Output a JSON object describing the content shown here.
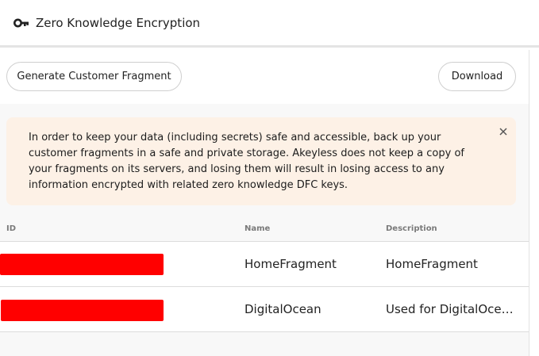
{
  "header": {
    "title": "Zero Knowledge Encryption",
    "icon": "key-icon"
  },
  "toolbar": {
    "generate_label": "Generate Customer Fragment",
    "download_label": "Download"
  },
  "alert": {
    "message": "In order to keep your data (including secrets) safe and accessible, back up your customer fragments in a safe and private storage. Akeyless does not keep a copy of your fragments on its servers, and losing them will result in losing access to any information encrypted with related zero knowledge DFC keys.",
    "background": "#fdf1e6"
  },
  "table": {
    "columns": [
      "ID",
      "Name",
      "Description"
    ],
    "rows": [
      {
        "id": "",
        "name": "HomeFragment",
        "description": "HomeFragment"
      },
      {
        "id": "",
        "name": "DigitalOcean",
        "description": "Used for DigitalOcean"
      }
    ]
  },
  "colors": {
    "redaction": "#ff0000"
  }
}
